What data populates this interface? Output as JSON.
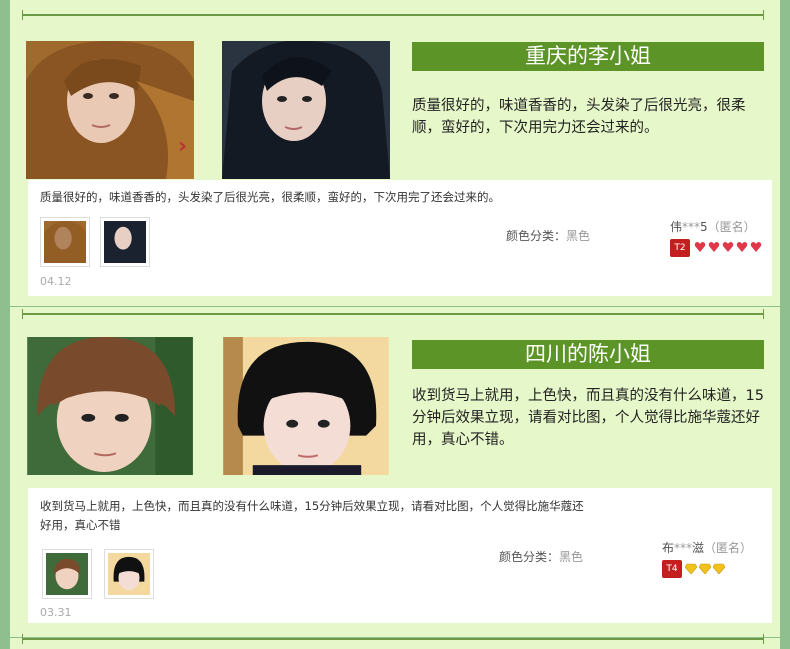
{
  "reviews": [
    {
      "title": "重庆的李小姐",
      "quote": "质量很好的，味道香香的，头发染了后很光亮，很柔顺，蛮好的，下次用完力还会过来的。",
      "review_text": "质量很好的，味道香香的，头发染了后很光亮，很柔顺，蛮好的，下次用完了还会过来的。",
      "color_label": "颜色分类：",
      "color_value": "黑色",
      "date": "04.12",
      "user_prefix": "伟",
      "user_stars": "***",
      "user_suffix": "5",
      "anon": "（匿名）",
      "badge": "T2",
      "level_icon": "red-heart-gem",
      "level_count": 5
    },
    {
      "title": "四川的陈小姐",
      "quote": "收到货马上就用，上色快，而且真的没有什么味道，15分钟后效果立现，请看对比图，个人觉得比施华蔻还好用，真心不错。",
      "review_text": "收到货马上就用，上色快，而且真的没有什么味道，15分钟后效果立现，请看对比图，个人觉得比施华蔻还好用，真心不错",
      "color_label": "颜色分类：",
      "color_value": "黑色",
      "date": "03.31",
      "user_prefix": "布",
      "user_stars": "***",
      "user_suffix": "滋",
      "anon": "（匿名）",
      "badge": "T4",
      "level_icon": "yellow-diamond",
      "level_count": 3
    }
  ],
  "colors": {
    "background": "#8fbf8f",
    "panel": "#e6f7c9",
    "title_bar": "#5c9427",
    "rule": "#6e9a47"
  }
}
